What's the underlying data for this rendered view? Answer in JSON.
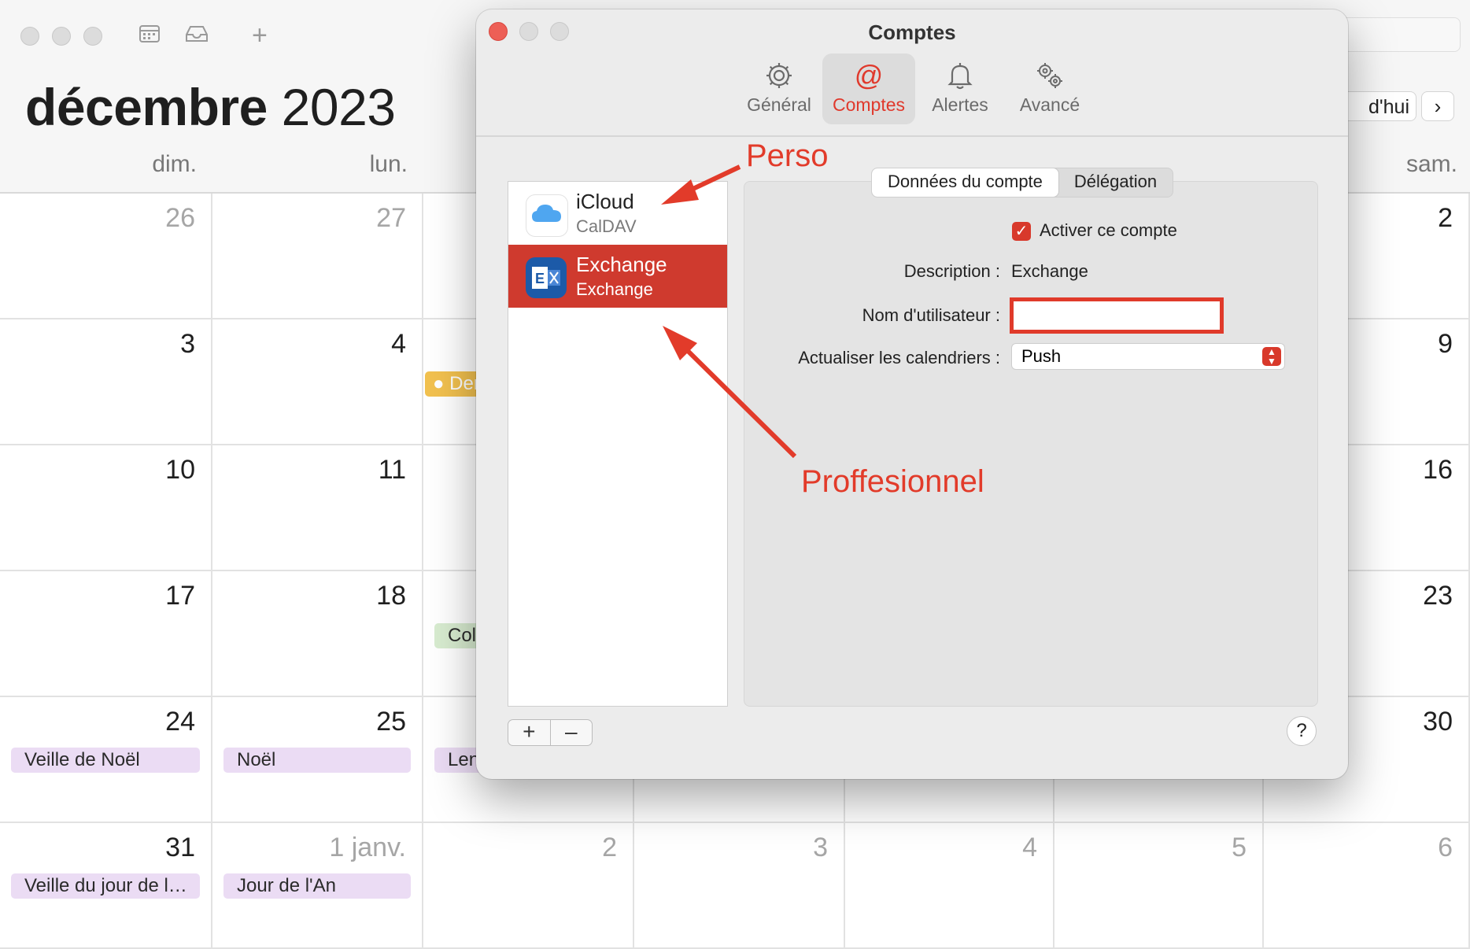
{
  "calendar": {
    "month": "décembre",
    "year": "2023",
    "today_label": "d'hui",
    "next_symbol": "›",
    "weekdays": [
      "dim.",
      "lun.",
      "sam."
    ],
    "rows": [
      {
        "sun": "26",
        "mon": "27",
        "sat": "2"
      },
      {
        "sun": "3",
        "mon": "4",
        "sat": "9"
      },
      {
        "sun": "10",
        "mon": "11",
        "sat": "16"
      },
      {
        "sun": "17",
        "mon": "18",
        "sat": "23"
      },
      {
        "sun": "24",
        "mon": "25",
        "sat": "30"
      },
      {
        "sun": "31",
        "mon": "1 janv.",
        "tue": "2",
        "wed": "3",
        "thu": "4",
        "fri": "5",
        "sat": "6"
      }
    ],
    "events": {
      "dec4_tue": "Der",
      "dec18_tue": "Col",
      "dec24_sun": "Veille de Noël",
      "dec25_mon": "Noël",
      "dec26_tue": "Len",
      "dec31_sun": "Veille du jour de l…",
      "jan1_mon": "Jour de l'An"
    }
  },
  "dialog": {
    "title": "Comptes",
    "tabs": [
      {
        "label": "Général",
        "icon": "gear-icon"
      },
      {
        "label": "Comptes",
        "icon": "at-icon"
      },
      {
        "label": "Alertes",
        "icon": "bell-icon"
      },
      {
        "label": "Avancé",
        "icon": "gears-icon"
      }
    ],
    "accounts": [
      {
        "name": "iCloud",
        "type": "CalDAV",
        "icon": "icloud-icon"
      },
      {
        "name": "Exchange",
        "type": "Exchange",
        "icon": "exchange-icon"
      }
    ],
    "segments": [
      "Données du compte",
      "Délégation"
    ],
    "enable_label": "Activer ce compte",
    "description_label": "Description :",
    "description_value": "Exchange",
    "username_label": "Nom d'utilisateur :",
    "username_value": "",
    "refresh_label": "Actualiser les calendriers :",
    "refresh_value": "Push",
    "add_symbol": "+",
    "remove_symbol": "–",
    "help_symbol": "?"
  },
  "annotations": {
    "perso": "Perso",
    "pro": "Proffesionnel",
    "color": "#e23b2a"
  }
}
